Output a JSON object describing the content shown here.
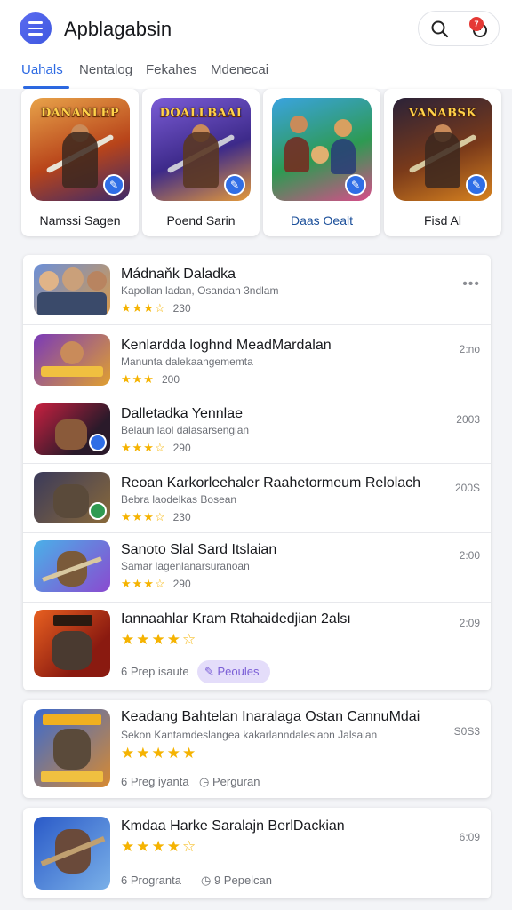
{
  "header": {
    "title": "Apblagabsin",
    "badge_count": "7"
  },
  "tabs": [
    "Uahals",
    "Nentalog",
    "Fekahes",
    "Mdenecai"
  ],
  "featured": [
    {
      "name": "Namssi Sagen",
      "art_title": "DANANLEP",
      "bg": "#c45a1a"
    },
    {
      "name": "Poend Sarin",
      "art_title": "DOALLBAAI",
      "bg": "#5b3a9c"
    },
    {
      "name": "Daas Oealt",
      "art_title": "",
      "bg": "#2f8a4a"
    },
    {
      "name": "Fisd Al",
      "art_title": "VANABSK",
      "bg": "#3b2a22"
    }
  ],
  "list": [
    {
      "title": "Mádnaňk Daladka",
      "subtitle": "Kapollan ladan, Osandan 3ndlam",
      "stars": "★★★☆",
      "count": "230",
      "time": ""
    },
    {
      "title": "Kenlardda loghnd MeadMardalan",
      "subtitle": "Manunta dalekaangememta",
      "stars": "★★★",
      "count": "200",
      "time": "2:no"
    },
    {
      "title": "Dalletadka Yennlae",
      "subtitle": "Belaun laol dalasarsengian",
      "stars": "★★★☆",
      "count": "290",
      "time": "2003"
    },
    {
      "title": "Reoan Karkorleehaler Raahetormeum Relolach",
      "subtitle": "Bebra laodelkas Bosean",
      "stars": "★★★☆",
      "count": "230",
      "time": "200S"
    },
    {
      "title": "Sanoto Slal Sard Itslaian",
      "subtitle": "Samar lagenlanarsuranoan",
      "stars": "★★★☆",
      "count": "290",
      "time": "2:00"
    }
  ],
  "list_last": {
    "title": "Iannaahlar Kram Rtahaidedjian 2alsı",
    "stars": "★★★★☆",
    "meta": "6 Prep isaute",
    "chip": "Peoules",
    "time": "2:09"
  },
  "cards": [
    {
      "title": "Keadang Bahtelan Inaralaga Ostan CannuMdai",
      "subtitle": "Sekon Kantamdeslangea kakarlanndaleslaon Jalsalan",
      "stars": "★★★★★",
      "meta1": "6 Preg iyanta",
      "meta2": "Perguran",
      "time": "S0S3"
    },
    {
      "title": "Kmdaa Harke Saralajn BerlDackian",
      "stars": "★★★★☆",
      "meta1": "6 Progranta",
      "meta2": "9 Pepelcan",
      "time": "6:09"
    }
  ]
}
